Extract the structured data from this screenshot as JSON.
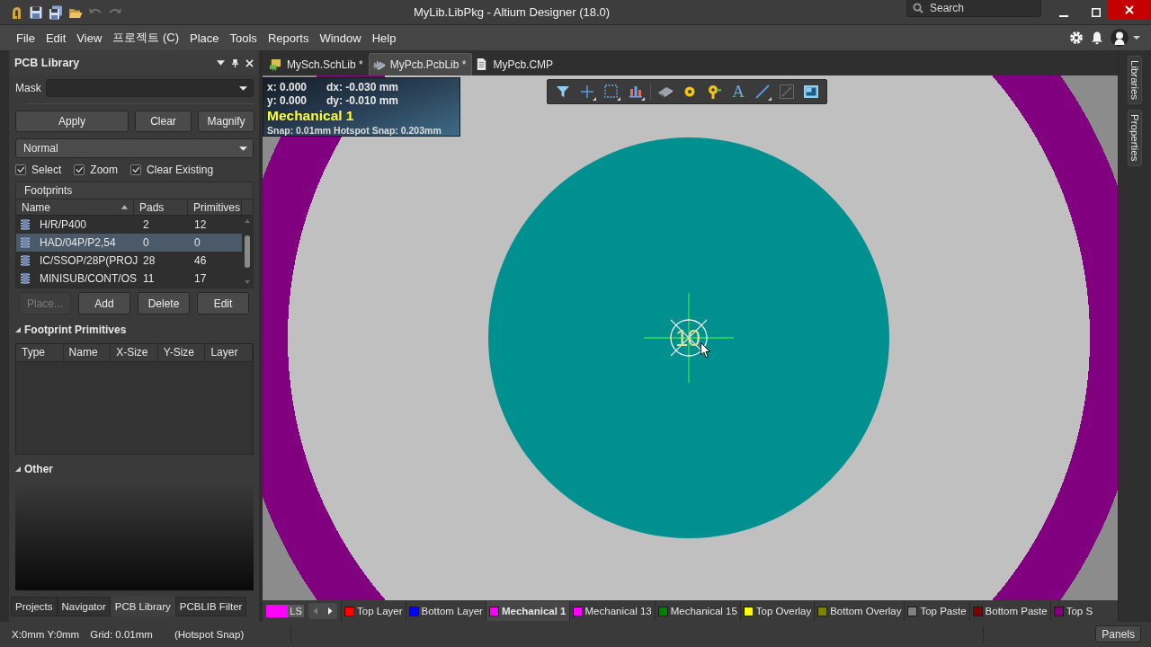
{
  "window": {
    "title": "MyLib.LibPkg - Altium Designer (18.0)",
    "search": {
      "placeholder": "Search"
    }
  },
  "menu": [
    "File",
    "Edit",
    "View",
    "프로젝트 (C)",
    "Place",
    "Tools",
    "Reports",
    "Window",
    "Help"
  ],
  "panel": {
    "title": "PCB Library",
    "mask_label": "Mask",
    "filter_buttons": [
      "Apply",
      "Clear",
      "Magnify"
    ],
    "mode": "Normal",
    "options": [
      {
        "label": "Select",
        "checked": true
      },
      {
        "label": "Zoom",
        "checked": true
      },
      {
        "label": "Clear Existing",
        "checked": true
      }
    ],
    "footprints": {
      "title": "Footprints",
      "columns": [
        "Name",
        "Pads",
        "Primitives"
      ],
      "rows": [
        {
          "name": "H/R/P400",
          "pads": "2",
          "primitives": "12",
          "selected": false
        },
        {
          "name": "HAD/04P/P2,54",
          "pads": "0",
          "primitives": "0",
          "selected": true
        },
        {
          "name": "IC/SSOP/28P(PROJ",
          "pads": "28",
          "primitives": "46",
          "selected": false
        },
        {
          "name": "MINISUB/CONT/OS",
          "pads": "11",
          "primitives": "17",
          "selected": false
        }
      ]
    },
    "footprint_buttons": [
      {
        "label": "Place...",
        "disabled": true
      },
      {
        "label": "Add",
        "disabled": false
      },
      {
        "label": "Delete",
        "disabled": false
      },
      {
        "label": "Edit",
        "disabled": false
      }
    ],
    "primitives": {
      "title": "Footprint Primitives",
      "expanded": true,
      "columns": [
        "Type",
        "Name",
        "X-Size",
        "Y-Size",
        "Layer"
      ]
    },
    "other": {
      "title": "Other",
      "expanded": true
    }
  },
  "panel_tabs": [
    {
      "label": "Projects",
      "selected": false
    },
    {
      "label": "Navigator",
      "selected": false
    },
    {
      "label": "PCB Library",
      "selected": true
    },
    {
      "label": "PCBLIB Filter",
      "selected": false
    }
  ],
  "document_tabs": [
    {
      "label": "MySch.SchLib *",
      "kind": "schlib",
      "selected": false
    },
    {
      "label": "MyPcb.PcbLib *",
      "kind": "pcblib",
      "selected": true
    },
    {
      "label": "MyPcb.CMP",
      "kind": "document",
      "selected": false
    }
  ],
  "hud": {
    "rows": [
      {
        "position": "x: 0.000",
        "delta": "dx: -0.030 mm"
      },
      {
        "position": "y: 0.000",
        "delta": "dy: -0.010 mm"
      }
    ],
    "layer": "Mechanical 1",
    "snap": "Snap: 0.01mm Hotspot Snap: 0.203mm"
  },
  "toolbar": {
    "text_tool": "A"
  },
  "canvas": {
    "marker_label": "10"
  },
  "side_tabs": [
    "Libraries",
    "Properties"
  ],
  "layer_bar": {
    "set_button": "LS",
    "layers": [
      {
        "name": "Top Layer",
        "color": "#ff0000",
        "selected": false
      },
      {
        "name": "Bottom Layer",
        "color": "#0000ff",
        "selected": false
      },
      {
        "name": "Mechanical 1",
        "color": "#ff00ff",
        "selected": true
      },
      {
        "name": "Mechanical 13",
        "color": "#ff00ff",
        "selected": false
      },
      {
        "name": "Mechanical 15",
        "color": "#008000",
        "selected": false
      },
      {
        "name": "Top Overlay",
        "color": "#ffff00",
        "selected": false
      },
      {
        "name": "Bottom Overlay",
        "color": "#808000",
        "selected": false
      },
      {
        "name": "Top Paste",
        "color": "#808080",
        "selected": false
      },
      {
        "name": "Bottom Paste",
        "color": "#800000",
        "selected": false
      },
      {
        "name": "Top S",
        "color": "#800080",
        "selected": false
      }
    ]
  },
  "status": {
    "fields": [
      "X:0mm Y:0mm",
      "Grid: 0.01mm",
      "(Hotspot Snap)"
    ],
    "panels_button": "Panels"
  }
}
